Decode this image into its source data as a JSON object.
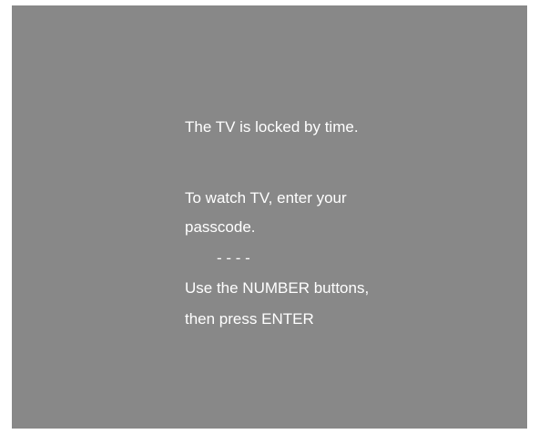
{
  "lock_message": {
    "title": "The TV is locked by time.",
    "instruction_line1": "To watch TV, enter your",
    "instruction_line2": "passcode.",
    "passcode_placeholder": "- - - -",
    "hint_line1": "Use the NUMBER buttons,",
    "hint_line2": "then press ENTER"
  },
  "colors": {
    "screen_background": "#888888",
    "text": "#ffffff"
  }
}
